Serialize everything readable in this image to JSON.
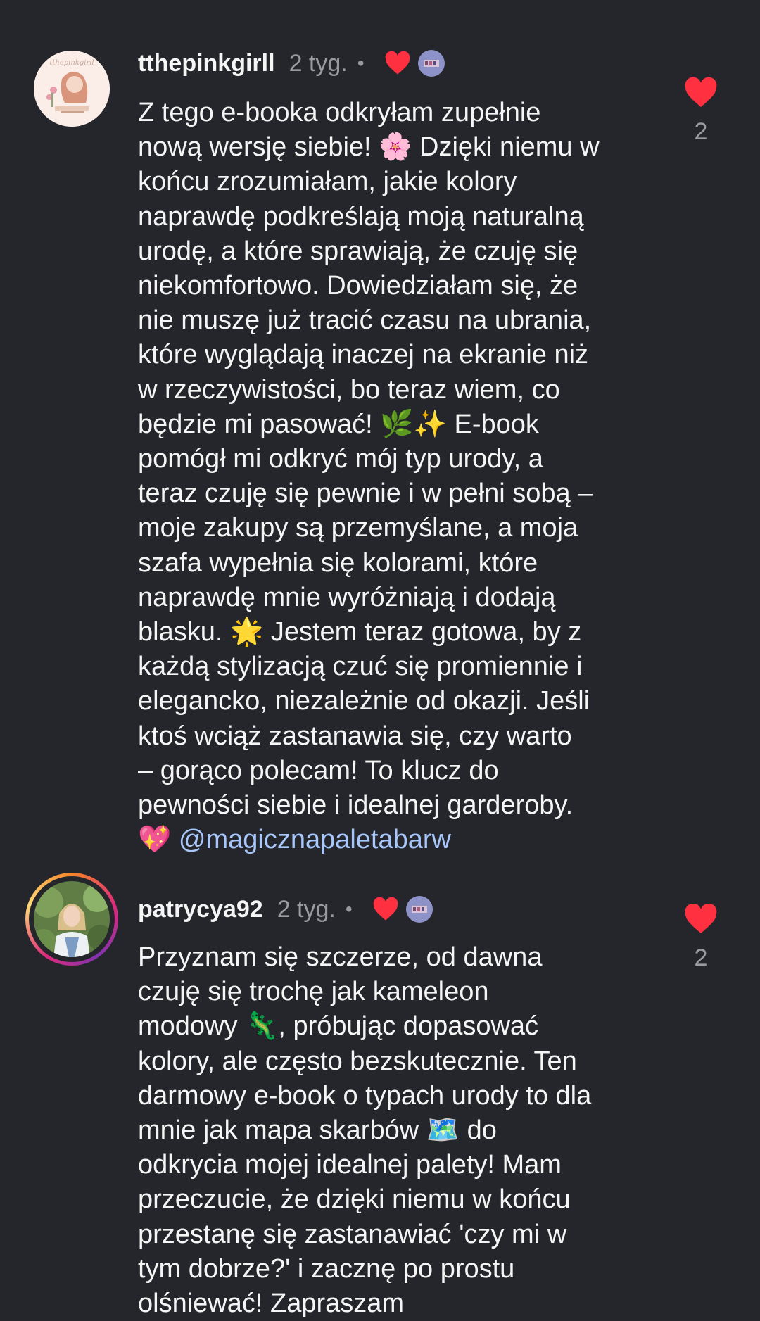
{
  "comments": [
    {
      "username": "tthepinkgirll",
      "time": "2 tyg.",
      "separator": "•",
      "avatar_icon": "girl-with-book-avatar",
      "avatar_text": "tthepinkgirll",
      "text_lines": [
        "Z tego e-booka odkryłam zupełnie",
        "nową wersję siebie! 🌸 Dzięki niemu w",
        "końcu zrozumiałam, jakie kolory",
        "naprawdę podkreślają moją naturalną",
        "urodę, a które sprawiają, że czuję się",
        "niekomfortowo. Dowiedziałam się, że",
        "nie muszę już tracić czasu na ubrania,",
        "które wyglądają inaczej na ekranie niż",
        "w rzeczywistości, bo teraz wiem, co",
        "będzie mi pasować! 🌿✨ E-book",
        "pomógł mi odkryć mój typ urody, a",
        "teraz czuję się pewnie i w pełni sobą –",
        "moje zakupy są przemyślane, a moja",
        "szafa wypełnia się kolorami, które",
        "naprawdę mnie wyróżniają i dodają",
        "blasku. 🌟 Jestem teraz gotowa, by z",
        "każdą stylizacją czuć się promiennie i",
        "elegancko, niezależnie od okazji. Jeśli",
        "ktoś wciąż zastanawia się, czy warto",
        "– gorąco polecam! To klucz do",
        "pewności siebie i idealnej garderoby."
      ],
      "last_line_prefix": "💖 ",
      "mention": "@magicznapaletabarw",
      "like_count": "2"
    },
    {
      "username": "patrycya92",
      "time": "2 tyg.",
      "separator": "•",
      "avatar_icon": "woman-photo-avatar",
      "text_lines": [
        "Przyznam się szczerze, od dawna",
        "czuję się trochę jak kameleon",
        "modowy 🦎, próbując dopasować",
        "kolory, ale często bezskutecznie. Ten",
        "darmowy e-book o typach urody to dla",
        "mnie jak mapa skarbów 🗺️ do",
        "odkrycia mojej idealnej palety! Mam",
        "przeczucie, że dzięki niemu w końcu",
        "przestanę się zastanawiać 'czy mi w",
        "tym dobrze?' i zacznę po prostu",
        "olśniewać! Zapraszam"
      ],
      "like_count": "2"
    }
  ],
  "colors": {
    "background": "#25262b",
    "heart": "#ff3040",
    "mention": "#a8c7fa",
    "muted": "#9a9ba0"
  }
}
